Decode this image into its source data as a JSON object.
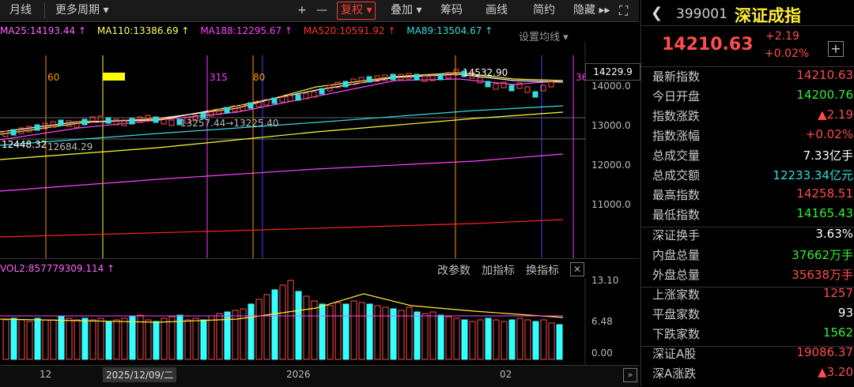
{
  "toolbar": {
    "items": [
      "月线",
      "更多周期 ▾",
      "+",
      "—",
      "复权 ▾",
      "叠加 ▾",
      "筹码",
      "画线",
      "简约",
      "隐藏 ▸▸"
    ]
  },
  "ma_line": [
    {
      "text": "MA25:14193.44 ↑",
      "color": "#ff66ff"
    },
    {
      "text": "MA110:13386.69 ↑",
      "color": "#ffff66"
    },
    {
      "text": "MA188:12295.67 ↑",
      "color": "#ff44ff"
    },
    {
      "text": "MA520:10591.92 ↑",
      "color": "#ff3333"
    },
    {
      "text": "MA89:13504.67 ↑",
      "color": "#33dddd"
    }
  ],
  "set_ma_label": "设置均线 ▾",
  "main_chart": {
    "current_price_label": "14229.9",
    "high_annotation": "14532.90",
    "low_annotation": "12448.32",
    "left_annotation2": "12684.29",
    "mid_annotation": "13257.44→13225.40",
    "period_labels": [
      "60",
      "315",
      "80",
      "36"
    ],
    "y_ticks": [
      "14000.0",
      "13000.0",
      "12000.0",
      "11000.0"
    ]
  },
  "volume": {
    "label": "VOL2:857779309.114 ↑",
    "buttons": [
      "改参数",
      "加指标",
      "换指标"
    ],
    "y_ticks": [
      "13.10",
      "6.48",
      "0.00"
    ]
  },
  "x_axis": {
    "labels": [
      "12",
      "2025/12/09/二",
      "2026",
      "02"
    ]
  },
  "quote": {
    "code": "399001",
    "name": "深证成指",
    "price": "14210.63",
    "change": "+2.19",
    "change_pct": "+0.02%",
    "rows": [
      {
        "label": "最新指数",
        "value": "14210.63",
        "color": "#ff4d4d"
      },
      {
        "label": "今日开盘",
        "value": "14200.76",
        "color": "#33ee33"
      },
      {
        "label": "指数涨跌",
        "value": "▲2.19",
        "color": "#ff4d4d"
      },
      {
        "label": "指数涨幅",
        "value": "+0.02%",
        "color": "#ff4d4d"
      },
      {
        "label": "总成交量",
        "value": "7.33亿手",
        "color": "#ffffff"
      },
      {
        "label": "总成交额",
        "value": "12233.34亿元",
        "color": "#33dddd"
      },
      {
        "label": "最高指数",
        "value": "14258.51",
        "color": "#ff4d4d"
      },
      {
        "label": "最低指数",
        "value": "14165.43",
        "color": "#33ee33"
      },
      {
        "label": "深证换手",
        "value": "3.63%",
        "color": "#ffffff"
      },
      {
        "label": "内盘总量",
        "value": "37662万手",
        "color": "#33ee33"
      },
      {
        "label": "外盘总量",
        "value": "35638万手",
        "color": "#ff4d4d"
      },
      {
        "label": "上涨家数",
        "value": "1257",
        "color": "#ff4d4d"
      },
      {
        "label": "平盘家数",
        "value": "93",
        "color": "#ffffff"
      },
      {
        "label": "下跌家数",
        "value": "1562",
        "color": "#33ee33"
      },
      {
        "label": "深证A股",
        "value": "19086.37",
        "color": "#ff4d4d"
      },
      {
        "label": "深A涨跌",
        "value": "▲3.20",
        "color": "#ff4d4d"
      }
    ]
  }
}
